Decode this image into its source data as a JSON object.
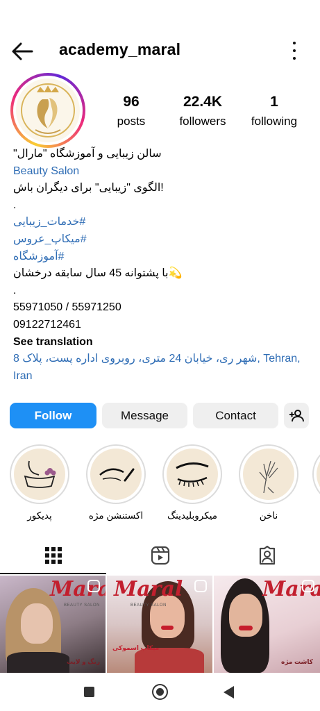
{
  "header": {
    "username": "academy_maral",
    "back_icon": "arrow-left-icon",
    "menu_icon": "more-vertical-icon"
  },
  "stats": {
    "posts": {
      "value": "96",
      "label": "posts"
    },
    "followers": {
      "value": "22.4K",
      "label": "followers"
    },
    "following": {
      "value": "1",
      "label": "following"
    }
  },
  "bio": {
    "name": "سالن زیبایی و آموزشگاه \"مارال\"",
    "category": "Beauty Salon",
    "line1": "!الگوی \"زیبایی\" برای دیگران باش",
    "dot1": ".",
    "tag1": "#خدمات_زیبایی",
    "tag2": "#میکاپ_عروس",
    "tag3": "#آموزشگاه",
    "line2": "💫با پشتوانه 45 سال سابقه درخشان",
    "dot2": ".",
    "phones": "55971050 / 55971250",
    "mobile": "09122712461",
    "see_translation": "See translation",
    "address": "شهر ری، خیابان 24 متری، روبروی اداره پست، پلاک 8, Tehran, Iran"
  },
  "actions": {
    "follow": "Follow",
    "message": "Message",
    "contact": "Contact",
    "add_user_icon": "person-add-icon"
  },
  "highlights": [
    {
      "label": "پدیکور",
      "icon": "foot-bath-icon"
    },
    {
      "label": "اکستنشن مژه",
      "icon": "eyelash-extension-icon"
    },
    {
      "label": "میکروبلیدینگ",
      "icon": "brow-icon"
    },
    {
      "label": "ناخن",
      "icon": "hand-nails-icon"
    }
  ],
  "tabs": [
    {
      "name": "posts-grid",
      "icon": "grid-icon",
      "active": true
    },
    {
      "name": "reels",
      "icon": "reels-icon",
      "active": false
    },
    {
      "name": "tagged",
      "icon": "tagged-person-icon",
      "active": false
    }
  ],
  "posts": [
    {
      "brand": "Maral",
      "sub": "BEAUTY SALON",
      "caption": "رنگ و لایت"
    },
    {
      "brand": "Maral",
      "sub": "BEAUTY SALON",
      "caption": "میکاپ اسموکی"
    },
    {
      "brand": "Maral",
      "sub": "",
      "caption": "کاشت مژه"
    }
  ],
  "colors": {
    "follow_button": "#1e90f5",
    "link": "#2f6db5",
    "secondary_button": "#efefef",
    "brand_red": "#c21f2e"
  }
}
